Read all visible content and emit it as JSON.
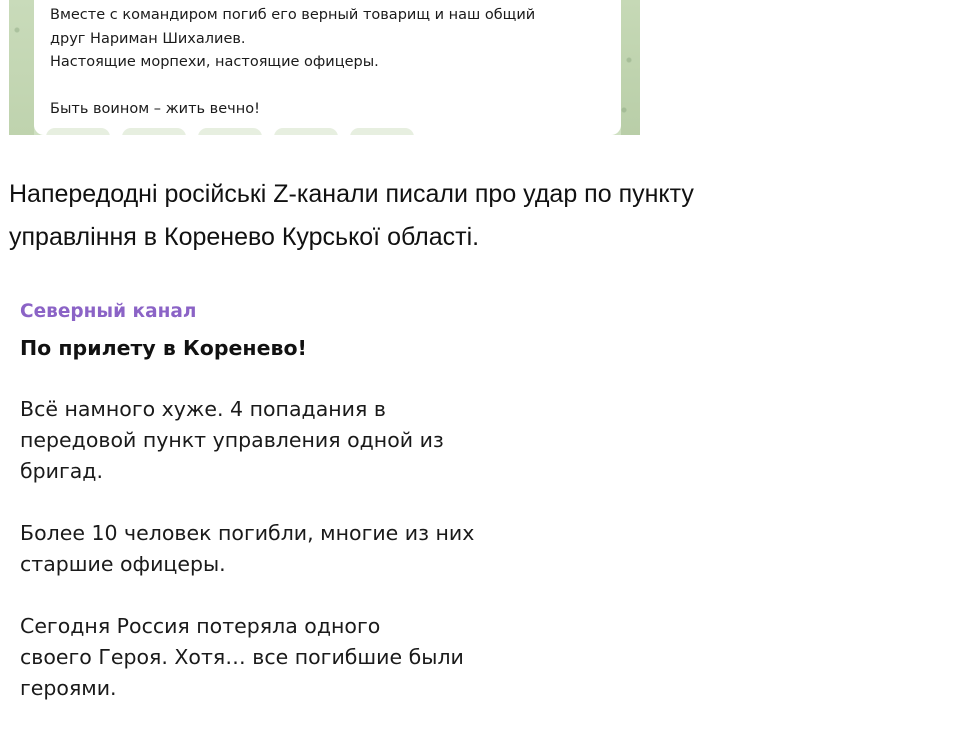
{
  "top_post": {
    "lines": [
      "Вместе с командиром погиб его верный товарищ и наш общий",
      "друг Нариман Шихалиев.",
      "Настоящие морпехи, настоящие  офицеры.",
      "",
      "Быть воином – жить вечно!"
    ]
  },
  "article": {
    "lines": [
      "Напередодні російські Z-канали писали про удар по пункту",
      "управління в Коренево Курської області."
    ]
  },
  "channel_post": {
    "channel_name": "Северный канал",
    "headline": "По прилету в Коренево!",
    "paragraphs": [
      [
        "Всё намного хуже. 4 попадания  в",
        "передовой пункт управления одной из",
        "бригад."
      ],
      [
        "Более 10 человек погибли, многие из них",
        "старшие офицеры."
      ],
      [
        "Сегодня Россия потеряла одного",
        "своего Героя. Хотя… все погибшие были",
        "героями."
      ]
    ]
  },
  "colors": {
    "channel_accent": "#8b63c6",
    "telegram_background": "#cfe0c2"
  }
}
